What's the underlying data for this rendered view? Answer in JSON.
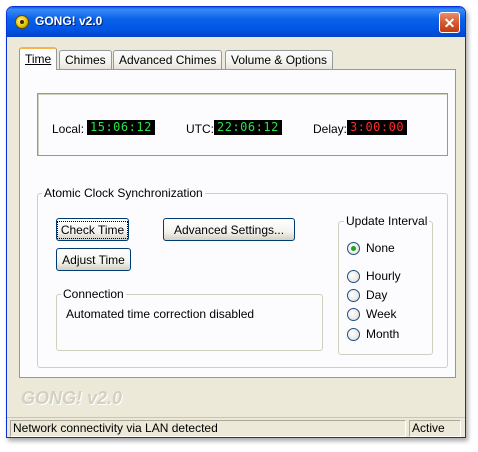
{
  "window": {
    "title": "GONG! v2.0",
    "close_glyph": "✕"
  },
  "tabs": [
    {
      "label": "Time"
    },
    {
      "label": "Chimes"
    },
    {
      "label": "Advanced Chimes"
    },
    {
      "label": "Volume & Options"
    }
  ],
  "clocks": {
    "local_label": "Local:",
    "local_value": "15:06:12",
    "utc_label": "UTC:",
    "utc_value": "22:06:12",
    "delay_label": "Delay:",
    "delay_value": "3:00:00"
  },
  "sync": {
    "group_label": "Atomic Clock Synchronization",
    "check_time_label": "Check Time",
    "adjust_time_label": "Adjust Time",
    "advanced_settings_label": "Advanced Settings...",
    "connection_label": "Connection",
    "connection_status": "Automated time correction disabled"
  },
  "update_interval": {
    "label": "Update Interval",
    "options": [
      "None",
      "Hourly",
      "Day",
      "Week",
      "Month"
    ],
    "selected": "None"
  },
  "logo_text": "GONG! v2.0",
  "statusbar": {
    "message": "Network connectivity via LAN detected",
    "state": "Active"
  },
  "colors": {
    "lcd_green": "#29e24a",
    "lcd_red": "#ff2b2b",
    "titlebar": "#0055e5"
  },
  "icons": [
    "gong-app-icon",
    "close-icon"
  ]
}
